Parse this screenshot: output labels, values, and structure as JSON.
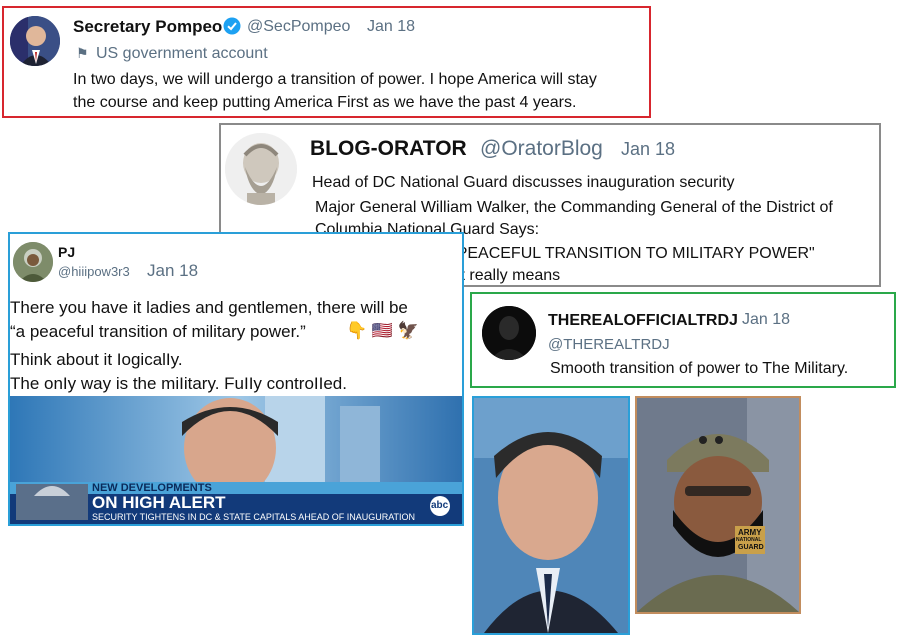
{
  "tweet1": {
    "name": "Secretary Pompeo",
    "handle": "@SecPompeo",
    "date": "Jan 18",
    "gov_label": "US government account",
    "line1": "In two days, we will undergo a transition of power. I hope America will stay",
    "line2": "the course and keep putting America First as we have the past 4 years."
  },
  "tweet2": {
    "name": "BLOG-ORATOR",
    "handle": "@OratorBlog",
    "date": "Jan 18",
    "line1": "Head of DC National Guard discusses inauguration security",
    "line2": "Major General William Walker, the Commanding General of the District of",
    "line3": "Columbia National Guard Says:",
    "line4": "\"THERE WILL BE A PEACEFUL TRANSITION TO MILITARY POWER\"",
    "line5": "Think about what that really means"
  },
  "tweet3": {
    "name": "PJ",
    "handle": "@hiiipow3r3",
    "date": "Jan 18",
    "line1": "There you have it ladies and gentlemen, there will be",
    "line2": "“a peaceful transition of military power.”",
    "line2_emoji": "👇 🇺🇸 🦅",
    "line3": "Think about it IogicalIy.",
    "line4": "The onIy way is the miIitary. FuIIy controIIed."
  },
  "news": {
    "kicker": "NEW DEVELOPMENTS",
    "headline": "ON HIGH ALERT",
    "subline": "SECURITY TIGHTENS IN DC & STATE CAPITALS AHEAD OF INAUGURATION",
    "network": "abc"
  },
  "tweet4": {
    "name": "THEREALOFFICIALTRDJ",
    "date": "Jan 18",
    "handle": "@THEREALTRDJ",
    "text": "Smooth transition of power to The Military."
  },
  "mask": {
    "line1": "ARMY",
    "line2": "NATIONAL",
    "line3": "GUARD"
  },
  "colors": {
    "red_border": "#d7262e",
    "gray_border": "#8a8a8a",
    "blue_border": "#2a9fd8",
    "green_border": "#2aa84a",
    "verified": "#1da1f2"
  },
  "icons": [
    "verified-badge-icon",
    "flag-icon",
    "bald-eagle-emoji",
    "us-flag-emoji",
    "pointing-down-emoji"
  ]
}
